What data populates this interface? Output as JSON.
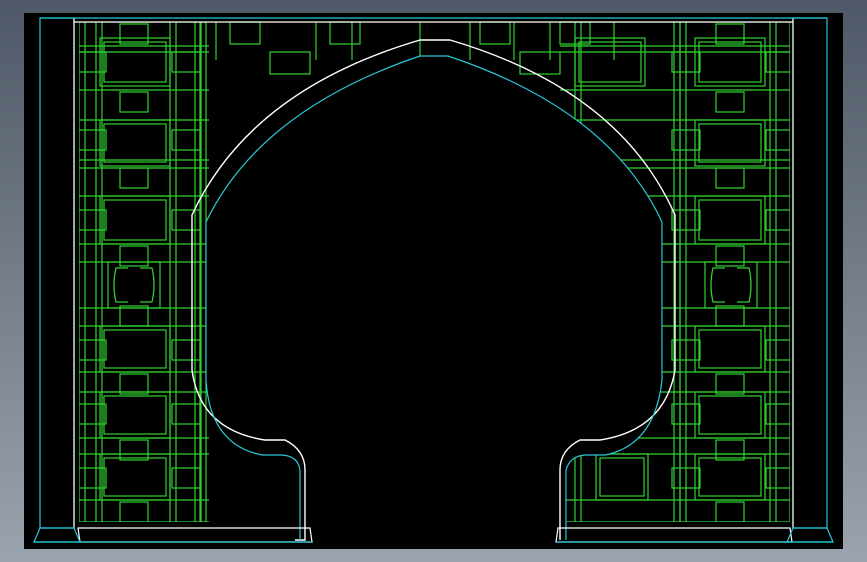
{
  "view": {
    "background_top": "#4f5866",
    "background_bottom": "#9aa3ae",
    "canvas_color": "#000000"
  },
  "colors": {
    "outline": "#ffffff",
    "lattice": "#2fd12f",
    "edge": "#27c8d8"
  },
  "drawing": {
    "subject": "moon-gate-lattice-screen",
    "lattice_panels": [
      "left-panel",
      "right-panel"
    ],
    "ornaments": [
      "left-bracket-ornament",
      "right-bracket-ornament"
    ]
  }
}
